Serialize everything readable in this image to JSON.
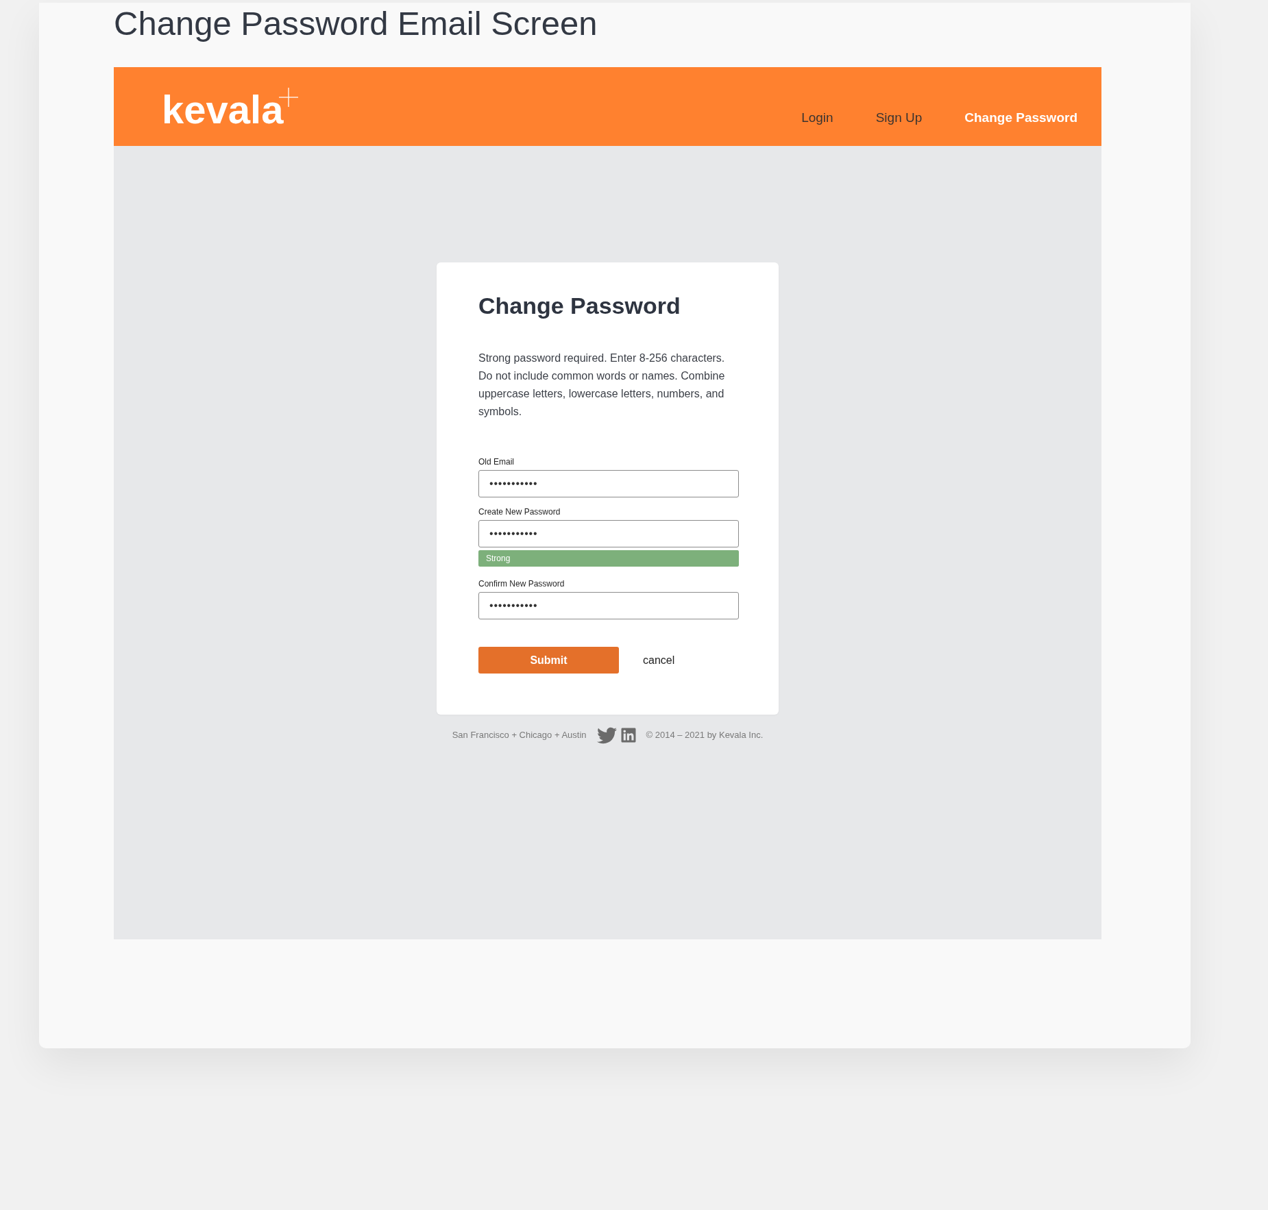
{
  "page_title": "Change Password Email Screen",
  "header": {
    "logo": "kevala",
    "nav": [
      {
        "label": "Login",
        "selected": false
      },
      {
        "label": "Sign Up",
        "selected": false
      },
      {
        "label": "Change Password",
        "selected": true
      }
    ]
  },
  "card": {
    "title": "Change Password",
    "description": "Strong password required. Enter 8-256 characters. Do not include common words or names. Combine uppercase letters, lowercase letters, numbers, and symbols.",
    "fields": [
      {
        "label": "Old Email",
        "value": "•••••••••••"
      },
      {
        "label": "Create New Password",
        "value": "•••••••••••",
        "strength": {
          "label": "Strong",
          "level": 1
        }
      },
      {
        "label": "Confirm New Password",
        "value": "•••••••••••"
      }
    ],
    "submit": "Submit",
    "cancel": "cancel"
  },
  "footer": {
    "locations": "San Francisco + Chicago + Austin",
    "copyright": "© 2014 – 2021 by Kevala Inc."
  }
}
